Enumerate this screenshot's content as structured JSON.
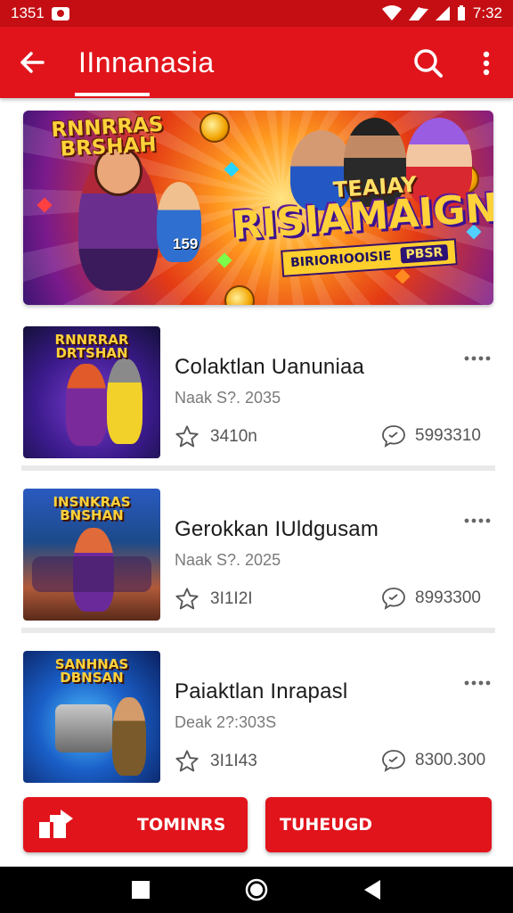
{
  "status_bar": {
    "left_text": "1351",
    "time": "7:32"
  },
  "app_bar": {
    "title": "IInnanasia"
  },
  "banner": {
    "logo_line1": "RNNRRAS",
    "logo_line2": "BRSHAH",
    "sub_title": "TEAIAY",
    "headline": "RISIAMAIGN",
    "ribbon_text": "BIRIORIOOISIE",
    "ribbon_tag": "PBSR",
    "side_number": "159"
  },
  "items": [
    {
      "thumb_title": "RNNRRAR DRTSHAN",
      "title": "Colaktlan Uanuniaa",
      "date": "Naak S?. 2035",
      "rating": "3410n",
      "comments": "5993310",
      "colors": {
        "bg_from": "#3a1a8a",
        "bg_to": "#15103a"
      }
    },
    {
      "thumb_title": "INSNKRAS BNSHAN",
      "title": "Gerokkan IUldgusam",
      "date": "Naak S?. 2025",
      "rating": "3I1I2I",
      "comments": "8993300",
      "colors": {
        "bg_from": "#1c4a8a",
        "bg_to": "#8a3a2a"
      }
    },
    {
      "thumb_title": "SANHNAS DBNSAN",
      "title": "Paiaktlan Inrapasl",
      "date": "Deak 2?:303S",
      "rating": "3I1I43",
      "comments": "8300.300",
      "colors": {
        "bg_from": "#1a5fc8",
        "bg_to": "#0a2060"
      }
    }
  ],
  "buttons": {
    "left_label": "TOMINRS",
    "right_label": "TUHEUGD"
  },
  "theme": {
    "primary": "#e1141c",
    "status_bar": "#c40e14"
  }
}
